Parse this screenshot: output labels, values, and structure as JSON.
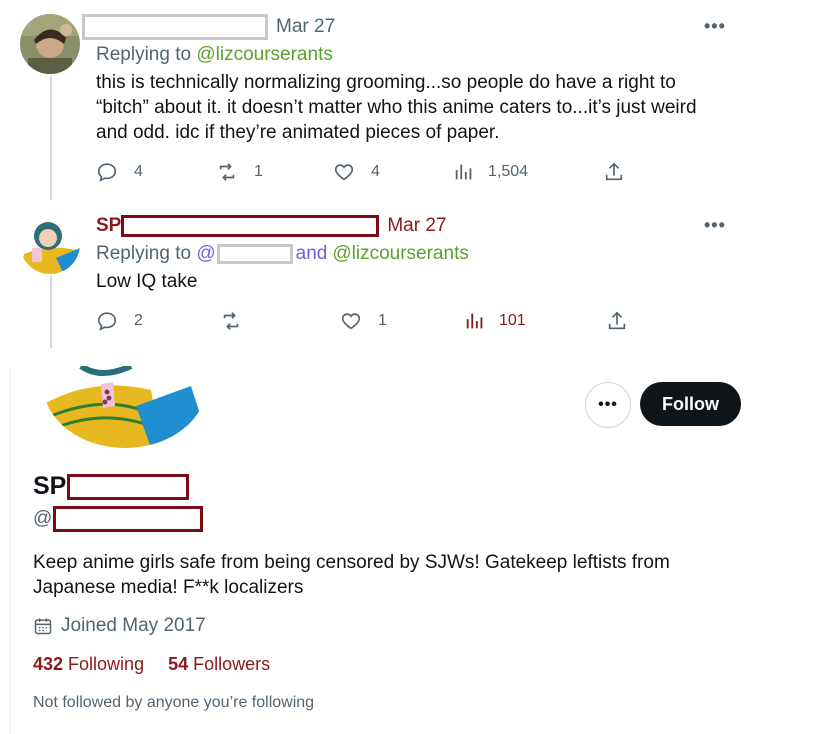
{
  "tweet1": {
    "date": "Mar 27",
    "replying_prefix": "Replying to ",
    "replying_handle": "@lizcourserants",
    "text_lines": [
      "this is technically normalizing grooming...so people do have a right to",
      "“bitch” about it. it doesn’t matter who this anime caters to...it’s just weird",
      "and odd. idc if they’re animated pieces of paper."
    ],
    "replies": "4",
    "retweets": "1",
    "likes": "4",
    "views": "1,504"
  },
  "tweet2": {
    "name_visible": "SP",
    "date": "Mar 27",
    "replying_prefix": "Replying to ",
    "replying_at": "@",
    "replying_and": "and",
    "replying_handle": "@lizcourserants",
    "text": "Low IQ take",
    "replies": "2",
    "likes": "1",
    "views": "101"
  },
  "profile": {
    "name_visible": "SP",
    "handle_prefix": "@",
    "follow_label": "Follow",
    "more_label": "•••",
    "bio_lines": [
      "Keep anime girls safe from being censored by SJWs! Gatekeep leftists from",
      "Japanese media! F**k localizers"
    ],
    "joined": "Joined May 2017",
    "following_count": "432",
    "following_label": "Following",
    "followers_count": "54",
    "followers_label": "Followers",
    "not_followed": "Not followed by anyone you’re following"
  },
  "ui": {
    "more_glyph": "•••"
  },
  "colors": {
    "text": "#0f1419",
    "muted": "#536471",
    "mention_green": "#5aa02c",
    "mention_purple": "#7b5cd6",
    "redaction_maroon": "#7a0a14",
    "stat_red": "#8b1a1a"
  }
}
